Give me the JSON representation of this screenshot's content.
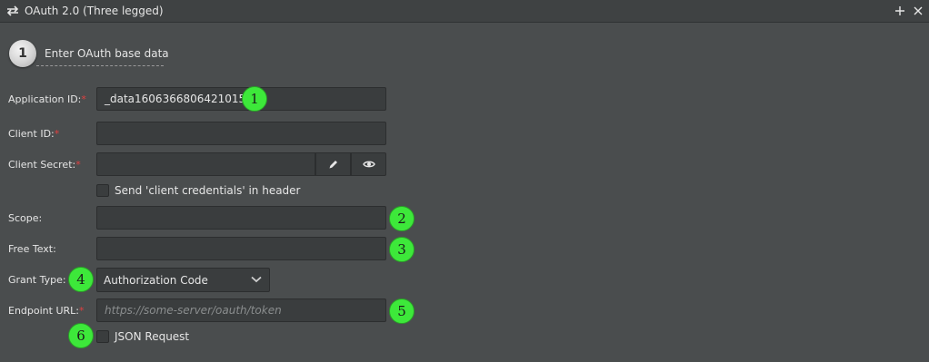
{
  "window": {
    "title": "OAuth 2.0 (Three legged)",
    "icon": "swap-arrows-icon",
    "actions": [
      "plus-icon",
      "close-icon"
    ]
  },
  "step": {
    "number": "1",
    "label": "Enter OAuth base data"
  },
  "form": {
    "application_id": {
      "label": "Application ID:",
      "required_mark": "*",
      "value": "_data1606366806421015"
    },
    "client_id": {
      "label": "Client ID:",
      "required_mark": "*",
      "value": ""
    },
    "client_secret": {
      "label": "Client Secret:",
      "required_mark": "*",
      "value": "",
      "buttons": [
        "pencil-icon",
        "eye-icon"
      ]
    },
    "send_credentials": {
      "label": "Send 'client credentials' in header",
      "checked": false
    },
    "scope": {
      "label": "Scope:",
      "value": ""
    },
    "free_text": {
      "label": "Free Text:",
      "value": ""
    },
    "grant_type": {
      "label": "Grant Type:",
      "selected": "Authorization Code"
    },
    "endpoint_url": {
      "label": "Endpoint URL:",
      "required_mark": "*",
      "value": "",
      "placeholder": "https://some-server/oauth/token"
    },
    "json_request": {
      "label": "JSON Request",
      "checked": false
    }
  },
  "annotations": [
    "1",
    "2",
    "3",
    "4",
    "5",
    "6"
  ],
  "colors": {
    "background": "#4a4d4e",
    "field": "#3a3d3e",
    "required": "#e04040",
    "annotation": "#3de83a"
  }
}
